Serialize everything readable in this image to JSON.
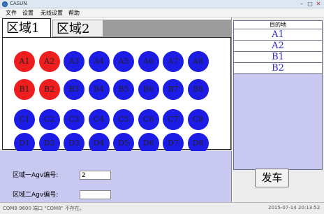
{
  "window": {
    "title": "CASUN"
  },
  "menu": [
    "文件",
    "设置",
    "无线设置",
    "帮助"
  ],
  "tabs": [
    {
      "label": "区域1",
      "active": true
    },
    {
      "label": "区域2",
      "active": false
    }
  ],
  "stations": {
    "row1": [
      {
        "label": "A1",
        "color": "red"
      },
      {
        "label": "A2",
        "color": "red"
      },
      {
        "label": "A3",
        "color": "blue"
      },
      {
        "label": "A4",
        "color": "blue"
      },
      {
        "label": "A5",
        "color": "blue"
      },
      {
        "label": "A6",
        "color": "blue"
      },
      {
        "label": "A7",
        "color": "blue"
      },
      {
        "label": "A8",
        "color": "blue"
      }
    ],
    "row2": [
      {
        "label": "B1",
        "color": "red"
      },
      {
        "label": "B2",
        "color": "red"
      },
      {
        "label": "B3",
        "color": "blue"
      },
      {
        "label": "B4",
        "color": "blue"
      },
      {
        "label": "B5",
        "color": "blue"
      },
      {
        "label": "B6",
        "color": "blue"
      },
      {
        "label": "B7",
        "color": "blue"
      },
      {
        "label": "B8",
        "color": "blue"
      }
    ],
    "row3": [
      {
        "label": "C1",
        "color": "blue"
      },
      {
        "label": "C2",
        "color": "blue"
      },
      {
        "label": "C3",
        "color": "blue"
      },
      {
        "label": "C4",
        "color": "blue"
      },
      {
        "label": "C5",
        "color": "blue"
      },
      {
        "label": "C6",
        "color": "blue"
      },
      {
        "label": "C7",
        "color": "blue"
      },
      {
        "label": "C8",
        "color": "blue"
      }
    ],
    "row4": [
      {
        "label": "D1",
        "color": "blue"
      },
      {
        "label": "D2",
        "color": "blue"
      },
      {
        "label": "D3",
        "color": "blue"
      },
      {
        "label": "D4",
        "color": "blue"
      },
      {
        "label": "D5",
        "color": "blue"
      },
      {
        "label": "D6",
        "color": "blue"
      },
      {
        "label": "D7",
        "color": "blue"
      },
      {
        "label": "D8",
        "color": "blue"
      }
    ]
  },
  "colors": {
    "red": "#ef1e1e",
    "blue": "#1c1ce6",
    "panel_bg": "#c8c8f0"
  },
  "destination": {
    "header": "目的地",
    "items": [
      "A1",
      "A2",
      "B1",
      "B2"
    ]
  },
  "fields": {
    "zone1_label": "区域一Agv编号:",
    "zone1_value": "2",
    "zone2_label": "区域二Agv编号:",
    "zone2_value": ""
  },
  "depart_button": "发车",
  "status": {
    "left": "COM8   9600   端口 \"COM8\" 不存在。",
    "right": "2015-07-14 20:13:52"
  }
}
